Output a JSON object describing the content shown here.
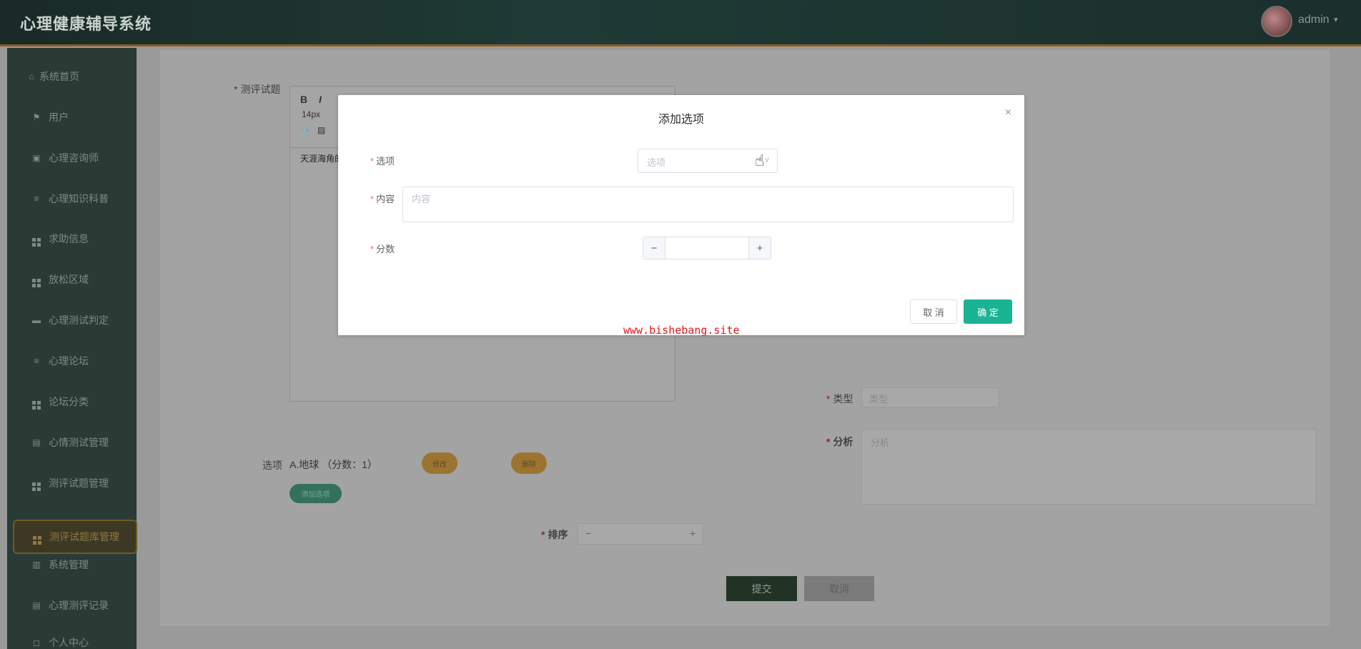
{
  "header": {
    "title": "心理健康辅导系统",
    "user": "admin",
    "caret": "▾"
  },
  "sidebar": {
    "items": [
      {
        "label": "系统首页",
        "icon": "home-icon",
        "glyph": "⌂"
      },
      {
        "label": "用户",
        "icon": "flag-icon",
        "glyph": "⚑"
      },
      {
        "label": "心理咨询师",
        "icon": "picture-icon",
        "glyph": "▣"
      },
      {
        "label": "心理知识科普",
        "icon": "menu-icon",
        "glyph": "≡"
      },
      {
        "label": "求助信息",
        "icon": "grid-icon"
      },
      {
        "label": "放松区域",
        "icon": "grid-icon"
      },
      {
        "label": "心理测试判定",
        "icon": "monitor-icon",
        "glyph": "▬"
      },
      {
        "label": "心理论坛",
        "icon": "menu-icon",
        "glyph": "≡"
      },
      {
        "label": "论坛分类",
        "icon": "grid-icon"
      },
      {
        "label": "心情测试管理",
        "icon": "clipboard-icon",
        "glyph": "▤"
      },
      {
        "label": "测评试题管理",
        "icon": "grid-icon"
      },
      {
        "label": "测评试题库管理",
        "icon": "grid-icon"
      },
      {
        "label": "系统管理",
        "icon": "book-icon",
        "glyph": "▥"
      },
      {
        "label": "心理测评记录",
        "icon": "clipboard-icon",
        "glyph": "▤"
      },
      {
        "label": "个人中心",
        "icon": "user-icon",
        "glyph": "◻"
      }
    ],
    "active_index": 11
  },
  "form": {
    "question_label": "测评试题",
    "editor": {
      "bold": "B",
      "italic": "I",
      "font_size": "14px",
      "text": "天涯海角的"
    },
    "type_label": "类型",
    "type_placeholder": "类型",
    "analysis_label": "分析",
    "analysis_placeholder": "分析",
    "options_label": "选项",
    "option_row": "A.地球 （分数：1）",
    "edit_btn": "修改",
    "delete_btn": "删除",
    "add_option_btn": "添加选项",
    "sort_label": "排序",
    "submit_btn": "提交",
    "cancel_btn": "取消"
  },
  "modal": {
    "title": "添加选项",
    "close": "×",
    "option_label": "选项",
    "option_placeholder": "选项",
    "content_label": "内容",
    "content_placeholder": "内容",
    "score_label": "分数",
    "minus": "−",
    "plus": "+",
    "cancel": "取 消",
    "ok": "确 定"
  },
  "watermark": "www.bishebang.site",
  "colors": {
    "accent": "#1ab394",
    "required": "#f56c6c",
    "watermark": "#e3161c"
  }
}
